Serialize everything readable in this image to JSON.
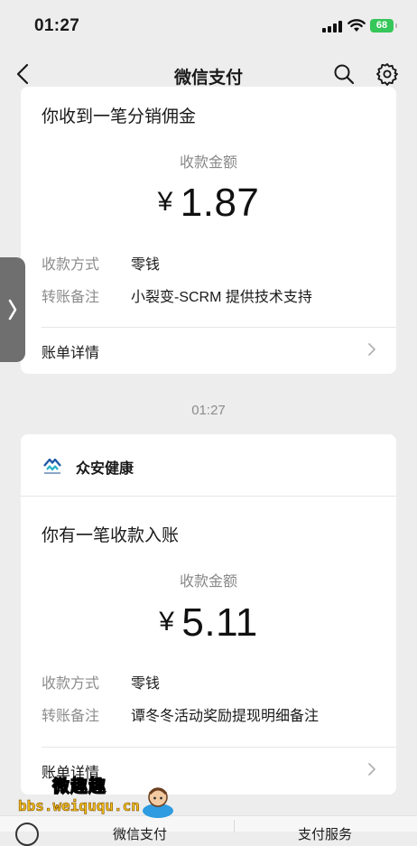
{
  "status_bar": {
    "time": "01:27",
    "battery": "68"
  },
  "nav": {
    "title": "微信支付"
  },
  "card1": {
    "title": "你收到一笔分销佣金",
    "amount_label": "收款金额",
    "currency": "¥",
    "amount": "1.87",
    "method_label": "收款方式",
    "method_value": "零钱",
    "note_label": "转账备注",
    "note_value": "小裂变-SCRM 提供技术支持",
    "bill_label": "账单详情"
  },
  "timestamp": "01:27",
  "card2": {
    "merchant": "众安健康",
    "title": "你有一笔收款入账",
    "amount_label": "收款金额",
    "currency": "¥",
    "amount": "5.11",
    "method_label": "收款方式",
    "method_value": "零钱",
    "note_label": "转账备注",
    "note_value": "谭冬冬活动奖励提现明细备注",
    "bill_label": "账单详情"
  },
  "watermark": {
    "text": "微趣趣",
    "url": "bbs.weiququ.cn"
  },
  "bottom_bar": {
    "item1": "微信支付",
    "item2": "支付服务"
  },
  "colors": {
    "background": "#ededed",
    "card": "#ffffff",
    "battery": "#35c759",
    "logo": "#1f5ba8"
  }
}
